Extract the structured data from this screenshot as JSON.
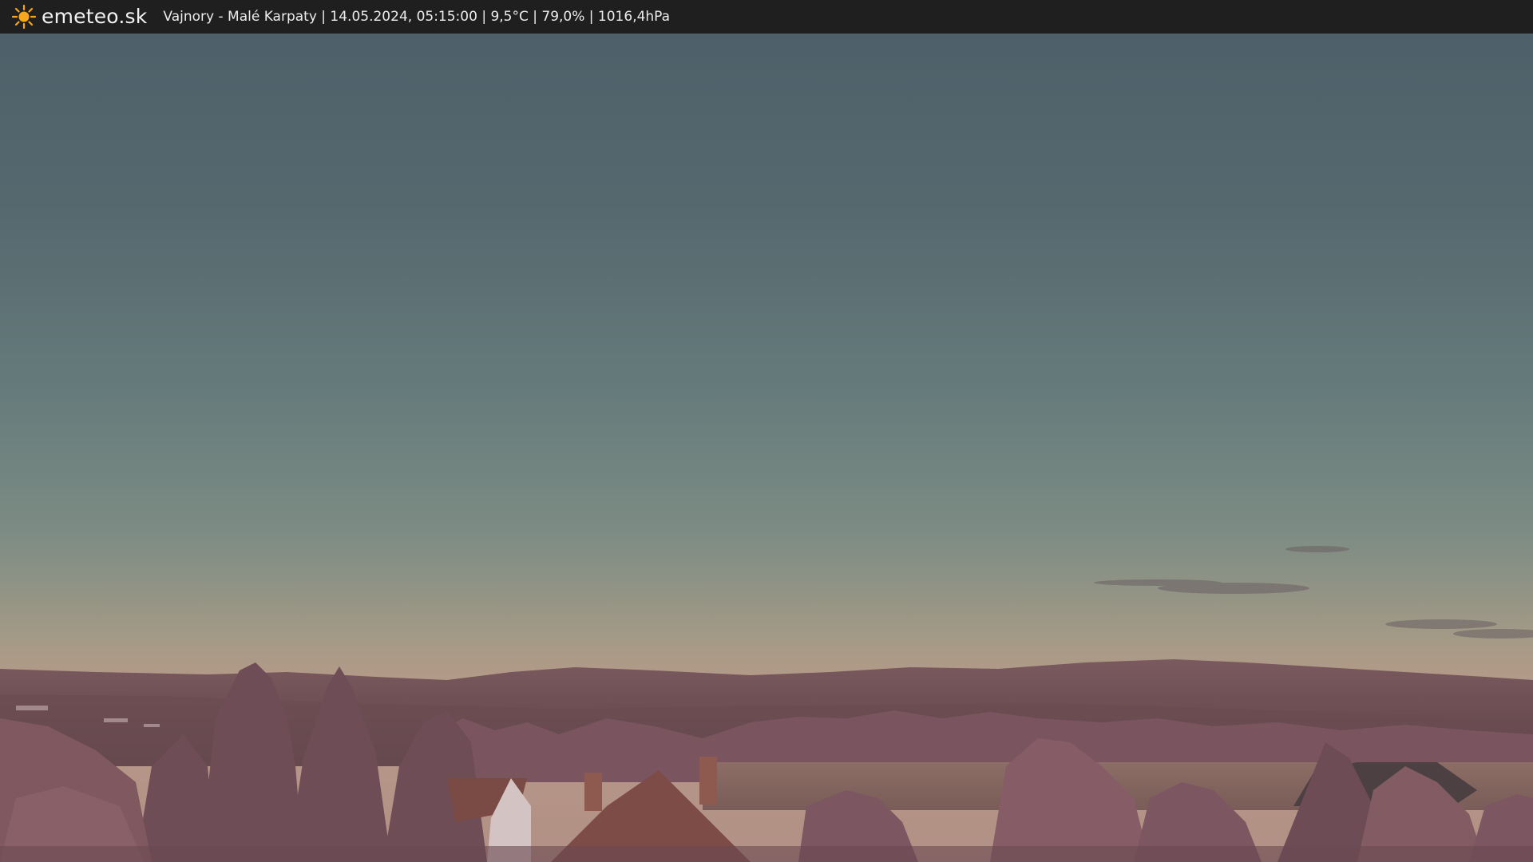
{
  "brand": {
    "name": "emeteo.sk",
    "icon": "sun-icon",
    "icon_color": "#f5a81c"
  },
  "caption": {
    "text": "Vajnory - Malé Karpaty | 14.05.2024, 05:15:00 | 9,5°C | 79,0% | 1016,4hPa"
  },
  "scene": {
    "description_colors": {
      "sky_top": "#4d5f68",
      "sky_mid": "#66807f",
      "horizon": "#b39a87",
      "hills": "#6e5054",
      "vegetation": "#7d5560"
    }
  }
}
